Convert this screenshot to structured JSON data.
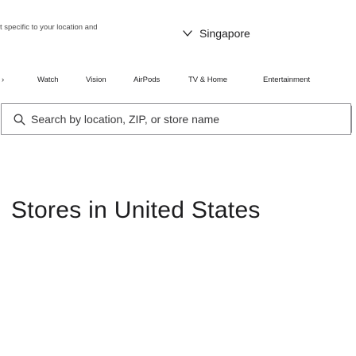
{
  "banner": {
    "text": "t specific to your location and",
    "region_label": "Singapore",
    "region_icon": "chevron-down-icon"
  },
  "nav": {
    "items": [
      {
        "label": "›"
      },
      {
        "label": "Watch"
      },
      {
        "label": "Vision"
      },
      {
        "label": "AirPods"
      },
      {
        "label": "TV & Home"
      },
      {
        "label": "Entertainment"
      }
    ]
  },
  "search": {
    "placeholder": "Search by location, ZIP, or store name",
    "value": "",
    "icon": "search-icon"
  },
  "main": {
    "title": "Stores in United States"
  }
}
